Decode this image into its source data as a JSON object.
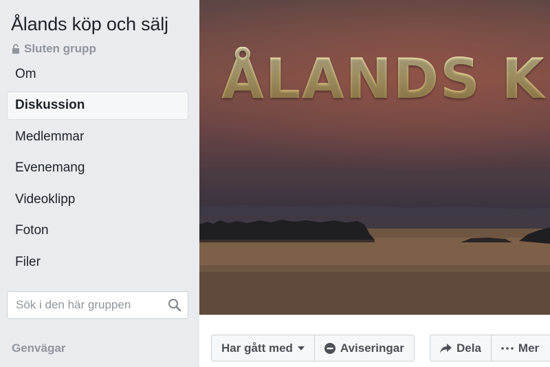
{
  "group": {
    "name": "Ålands köp och sälj",
    "privacy_label": "Sluten grupp"
  },
  "nav": {
    "items": [
      {
        "label": "Om",
        "active": false
      },
      {
        "label": "Diskussion",
        "active": true
      },
      {
        "label": "Medlemmar",
        "active": false
      },
      {
        "label": "Evenemang",
        "active": false
      },
      {
        "label": "Videoklipp",
        "active": false
      },
      {
        "label": "Foton",
        "active": false
      },
      {
        "label": "Filer",
        "active": false
      }
    ]
  },
  "search": {
    "placeholder": "Sök i den här gruppen",
    "value": ""
  },
  "shortcuts_label": "Genvägar",
  "cover": {
    "title_text": "ÅLANDS K"
  },
  "actions": {
    "joined_label": "Har gått med",
    "notifications_label": "Aviseringar",
    "share_label": "Dela",
    "more_label": "Mer"
  },
  "icons": {
    "privacy": "lock-icon",
    "search": "search-icon",
    "joined_dropdown": "caret-down-icon",
    "notifications": "no-entry-icon",
    "share": "share-arrow-icon",
    "more": "ellipsis-icon"
  },
  "colors": {
    "background": "#e9ebee",
    "muted_text": "#90949c",
    "button_text": "#4b4f56",
    "cover_title_gold": "#e8d28f"
  }
}
